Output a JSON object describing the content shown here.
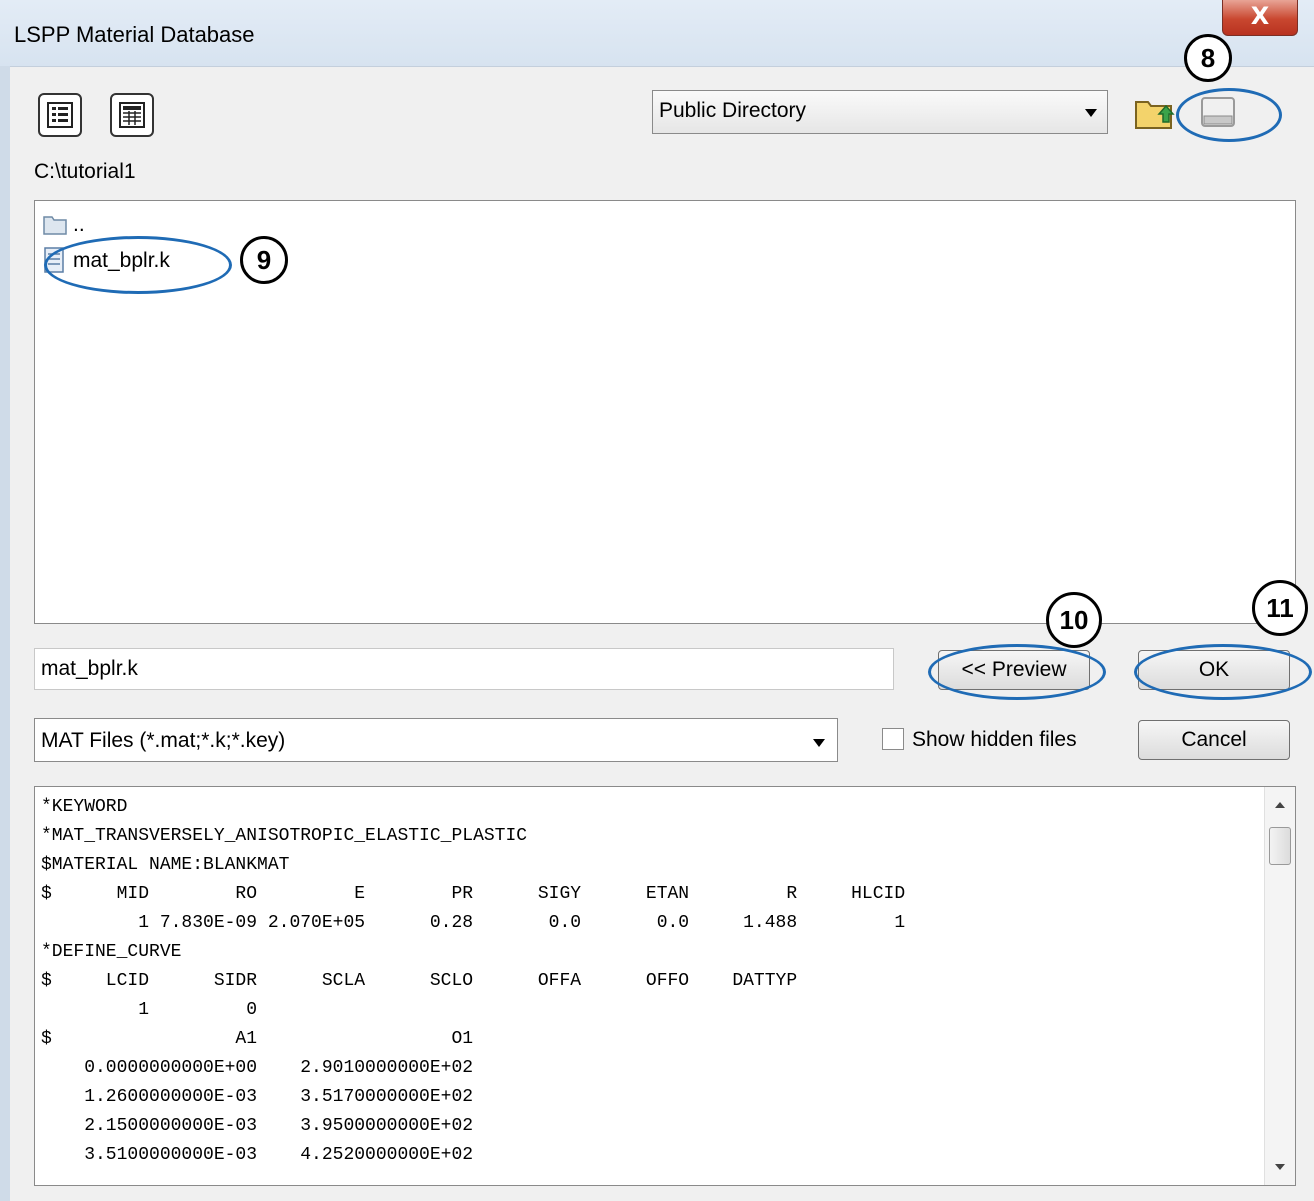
{
  "window": {
    "title": "LSPP Material Database",
    "close_glyph": "X"
  },
  "toolbar": {
    "list_view_icon": "details-list-icon",
    "grid_view_icon": "grid-list-icon",
    "directory_select": "Public Directory",
    "up_folder_icon": "folder-up-icon",
    "drive_icon": "drive-icon"
  },
  "path": "C:\\tutorial1",
  "files": [
    {
      "name": "..",
      "type": "folder",
      "icon": "folder-icon"
    },
    {
      "name": "mat_bplr.k",
      "type": "file",
      "icon": "file-icon"
    }
  ],
  "filename_value": "mat_bplr.k",
  "buttons": {
    "preview": "<< Preview",
    "ok": "OK",
    "cancel": "Cancel"
  },
  "filter": "MAT Files (*.mat;*.k;*.key)",
  "show_hidden_label": "Show hidden files",
  "preview_lines": [
    "*KEYWORD",
    "*MAT_TRANSVERSELY_ANISOTROPIC_ELASTIC_PLASTIC",
    "$MATERIAL NAME:BLANKMAT",
    "$      MID        RO         E        PR      SIGY      ETAN         R     HLCID",
    "         1 7.830E-09 2.070E+05      0.28       0.0       0.0     1.488         1",
    "*DEFINE_CURVE",
    "$     LCID      SIDR      SCLA      SCLO      OFFA      OFFO    DATTYP",
    "         1         0",
    "$                 A1                  O1",
    "    0.0000000000E+00    2.9010000000E+02",
    "    1.2600000000E-03    3.5170000000E+02",
    "    2.1500000000E-03    3.9500000000E+02",
    "    3.5100000000E-03    4.2520000000E+02"
  ],
  "annotations": [
    "8",
    "9",
    "10",
    "11"
  ],
  "colors": {
    "highlight_ellipse": "#1f6bb5",
    "title_bar": "#dbe6f2",
    "close_button": "#c9472f"
  }
}
